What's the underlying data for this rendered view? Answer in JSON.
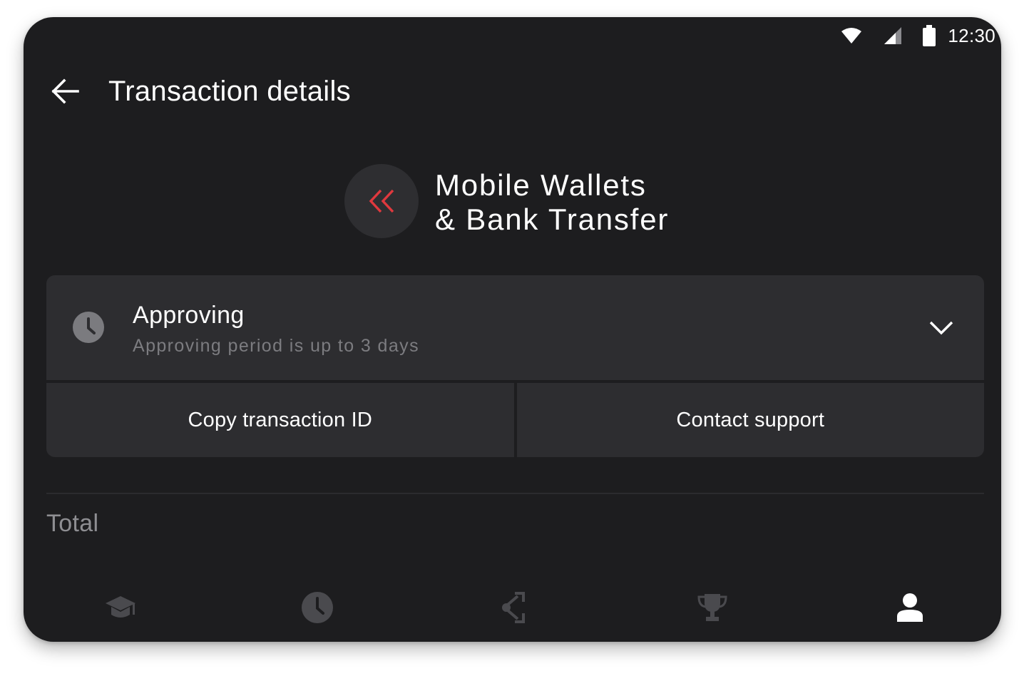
{
  "status_bar": {
    "time": "12:30",
    "icons": [
      "wifi-icon",
      "cellular-signal-icon",
      "battery-icon"
    ]
  },
  "app_bar": {
    "back_icon": "arrow-left-icon",
    "title": "Transaction details"
  },
  "method": {
    "icon": "double-chevron-left-icon",
    "title_line1": "Mobile Wallets",
    "title_line2": "& Bank Transfer"
  },
  "status": {
    "icon": "clock-icon",
    "title": "Approving",
    "subtitle": "Approving period is up to 3 days",
    "expand_icon": "chevron-down-icon"
  },
  "actions": {
    "copy_label": "Copy transaction ID",
    "support_label": "Contact support"
  },
  "total": {
    "label": "Total"
  },
  "bottom_nav": {
    "items": [
      {
        "icon": "graduation-cap-icon",
        "active": false
      },
      {
        "icon": "clock-icon",
        "active": false
      },
      {
        "icon": "share-icon",
        "active": false
      },
      {
        "icon": "trophy-icon",
        "active": false
      },
      {
        "icon": "user-icon",
        "active": true
      }
    ]
  },
  "colors": {
    "background": "#1d1d1f",
    "card": "#2d2d30",
    "accent_red": "#e0393e",
    "muted_text": "#7c7c80",
    "inactive_icon": "#4a4a4e",
    "active_icon": "#ffffff"
  }
}
